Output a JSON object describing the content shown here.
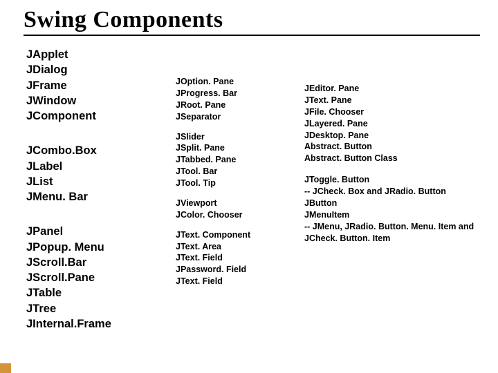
{
  "title": "Swing Components",
  "col1": {
    "g1": [
      "JApplet",
      "JDialog",
      "JFrame",
      "JWindow",
      "JComponent"
    ],
    "g2": [
      "JCombo.Box",
      "JLabel",
      "JList",
      "JMenu. Bar"
    ],
    "g3": [
      "JPanel",
      "JPopup. Menu",
      "JScroll.Bar",
      "JScroll.Pane",
      "JTable",
      "JTree",
      "JInternal.Frame"
    ]
  },
  "col2": {
    "g1": [
      "JOption. Pane",
      "JProgress. Bar",
      "JRoot. Pane",
      "JSeparator"
    ],
    "g2": [
      "JSlider",
      "JSplit. Pane",
      "JTabbed. Pane",
      "JTool. Bar",
      "JTool. Tip"
    ],
    "g3": [
      "JViewport",
      "JColor. Chooser"
    ],
    "g4": [
      "JText. Component",
      "JText. Area",
      "JText. Field",
      "JPassword. Field",
      "JText. Field"
    ]
  },
  "col3": {
    "g1": [
      "JEditor. Pane",
      "JText. Pane",
      "JFile. Chooser",
      "JLayered. Pane",
      "JDesktop. Pane",
      "Abstract. Button",
      "Abstract. Button Class"
    ],
    "g2": [
      "JToggle. Button",
      "-- JCheck. Box and JRadio. Button",
      "JButton",
      "JMenuItem",
      "-- JMenu, JRadio. Button. Menu. Item and JCheck. Button. Item"
    ]
  }
}
